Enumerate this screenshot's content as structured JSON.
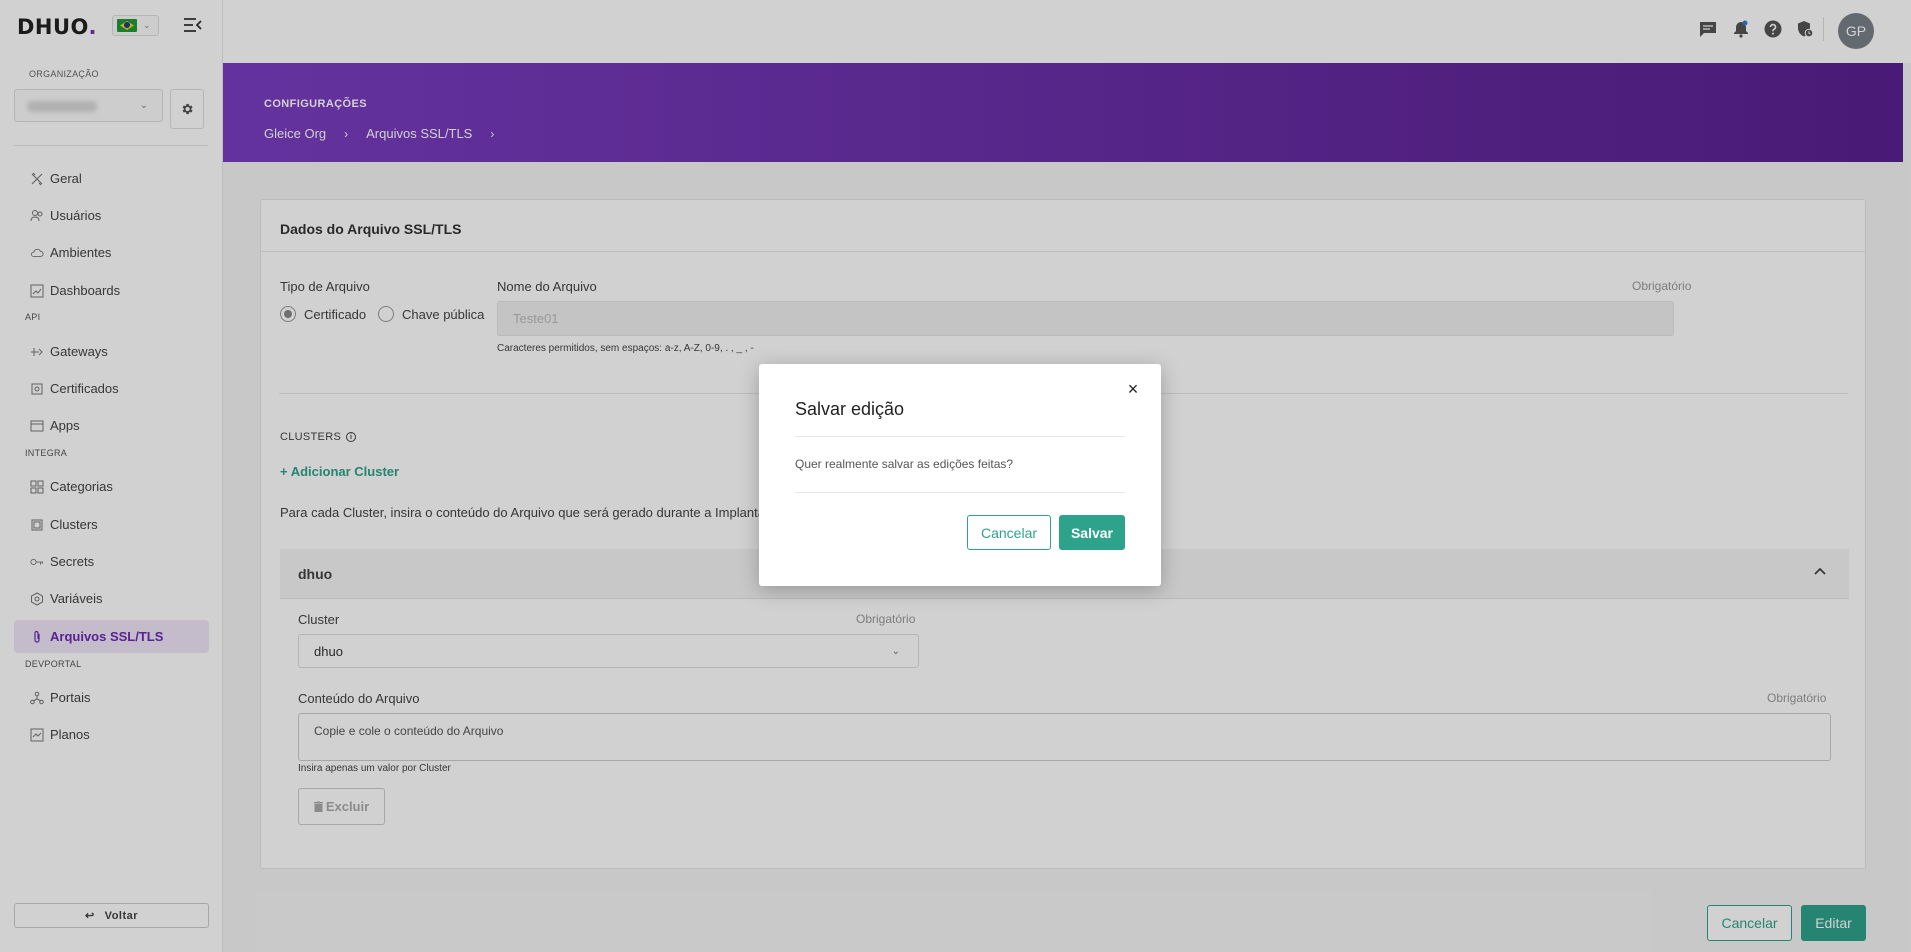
{
  "app": {
    "logo": "DHUO",
    "logo_dot": "."
  },
  "colors": {
    "brand_purple": "#6b2bb2",
    "accent_green": "#2ea38c"
  },
  "sidebar": {
    "org_label": "ORGANIZAÇÃO",
    "sections": {
      "api": "API",
      "integra": "INTEGRA",
      "devportal": "DEVPORTAL"
    },
    "items": [
      {
        "label": "Geral",
        "icon": "tools-icon"
      },
      {
        "label": "Usuários",
        "icon": "users-icon"
      },
      {
        "label": "Ambientes",
        "icon": "cloud-icon"
      },
      {
        "label": "Dashboards",
        "icon": "dashboard-icon"
      },
      {
        "label": "Gateways",
        "icon": "gateway-icon"
      },
      {
        "label": "Certificados",
        "icon": "certificate-icon"
      },
      {
        "label": "Apps",
        "icon": "apps-icon"
      },
      {
        "label": "Categorias",
        "icon": "categories-icon"
      },
      {
        "label": "Clusters",
        "icon": "clusters-icon"
      },
      {
        "label": "Secrets",
        "icon": "key-icon"
      },
      {
        "label": "Variáveis",
        "icon": "variables-icon"
      },
      {
        "label": "Arquivos SSL/TLS",
        "icon": "paperclip-icon",
        "active": true
      },
      {
        "label": "Portais",
        "icon": "portals-icon"
      },
      {
        "label": "Planos",
        "icon": "plans-icon"
      }
    ],
    "back_label": "Voltar",
    "back_arrow": "↩"
  },
  "topbar": {
    "avatar_initials": "GP"
  },
  "hero": {
    "title": "CONFIGURAÇÕES",
    "crumbs": [
      "Gleice Org",
      "Arquivos SSL/TLS"
    ],
    "crumb_sep": "›"
  },
  "form": {
    "card_title": "Dados do Arquivo SSL/TLS",
    "tipo_label": "Tipo de Arquivo",
    "radio_cert": "Certificado",
    "radio_chave": "Chave pública",
    "nome_label": "Nome do Arquivo",
    "required": "Obrigatório",
    "nome_value": "Teste01",
    "nome_hint": "Caracteres permitidos, sem espaços: a-z, A-Z, 0-9, . , _ , -",
    "clusters_label": "CLUSTERS",
    "add_cluster": "+ Adicionar Cluster",
    "clusters_paragraph": "Para cada Cluster, insira o conteúdo do Arquivo que será gerado durante a Implantação",
    "accordion_title": "dhuo",
    "cluster_label": "Cluster",
    "cluster_value": "dhuo",
    "conteudo_label": "Conteúdo do Arquivo",
    "conteudo_placeholder": "Copie e cole o conteúdo do Arquivo",
    "conteudo_hint": "Insira apenas um valor por Cluster",
    "delete_label": "Excluir"
  },
  "footer": {
    "cancel": "Cancelar",
    "edit": "Editar"
  },
  "modal": {
    "title": "Salvar edição",
    "message": "Quer realmente salvar as edições feitas?",
    "cancel": "Cancelar",
    "save": "Salvar",
    "close": "×"
  }
}
